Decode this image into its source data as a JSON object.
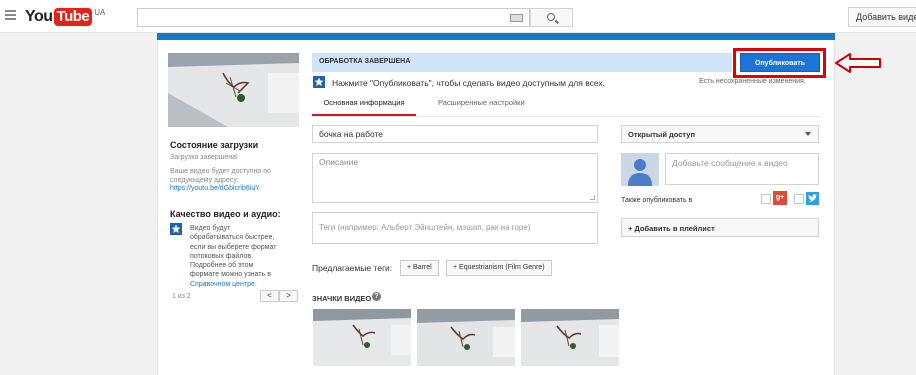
{
  "header": {
    "logo_you": "You",
    "logo_tube": "Tube",
    "logo_region": "UA",
    "search_placeholder": "",
    "add_video_label": "Добавить видео"
  },
  "sidebar": {
    "status_title": "Состояние загрузки",
    "status_text": "Загрузка завершена!",
    "available_text": "Ваше видео будет доступно по следующему адресу:",
    "video_link": "https://youtu.be/dGblcrib6iuY",
    "quality_title": "Качество видео и аудио:",
    "quality_info_prefix": "Видео будут обрабатываться быстрее, если вы выберете формат потоковых файлов. Подробнее об этом формате можно узнать в",
    "quality_info_link": "Справочном центре",
    "quality_info_suffix": ".",
    "pager_text": "1 из 2",
    "pager_prev": "<",
    "pager_next": ">"
  },
  "processing": {
    "banner_label": "ОБРАБОТКА ЗАВЕРШЕНА",
    "publish_label": "Опубликовать",
    "hint": "Нажмите \"Опубликовать\", чтобы сделать видео доступным для всех.",
    "unsaved": "Есть несохраненные изменения."
  },
  "tabs": [
    {
      "label": "Основная информация",
      "active": true
    },
    {
      "label": "Расширенные настройки",
      "active": false
    }
  ],
  "form": {
    "title_value": "бочка на работе",
    "description_placeholder": "Описание",
    "tags_placeholder": "Теги (например: Альберт Эйнштейн, мэшап, рак на горе)",
    "suggested_label": "Предлагаемые теги:",
    "suggested_tags": [
      "+ Barrel",
      "+ Equestrianism (Film Genre)"
    ],
    "thumbnails_label": "ЗНАЧКИ ВИДЕО",
    "help_glyph": "?"
  },
  "right": {
    "privacy_value": "Открытый доступ",
    "message_placeholder": "Добавьте сообщение к видео",
    "also_publish_label": "Также опубликовать в",
    "gplus_glyph": "g+",
    "add_playlist_label": "+ Добавить в плейлист"
  },
  "colors": {
    "brand_red": "#e62117",
    "accent_blue": "#167ac6",
    "publish_blue": "#1c74d6",
    "highlight_red": "#e00000",
    "banner_blue": "#cfe4f8"
  },
  "icons": [
    "menu-icon",
    "keyboard-icon",
    "search-icon",
    "star-icon",
    "info-icon",
    "help-icon",
    "caret-down-icon",
    "avatar-icon",
    "google-plus-icon",
    "twitter-icon",
    "arrow-icon"
  ]
}
